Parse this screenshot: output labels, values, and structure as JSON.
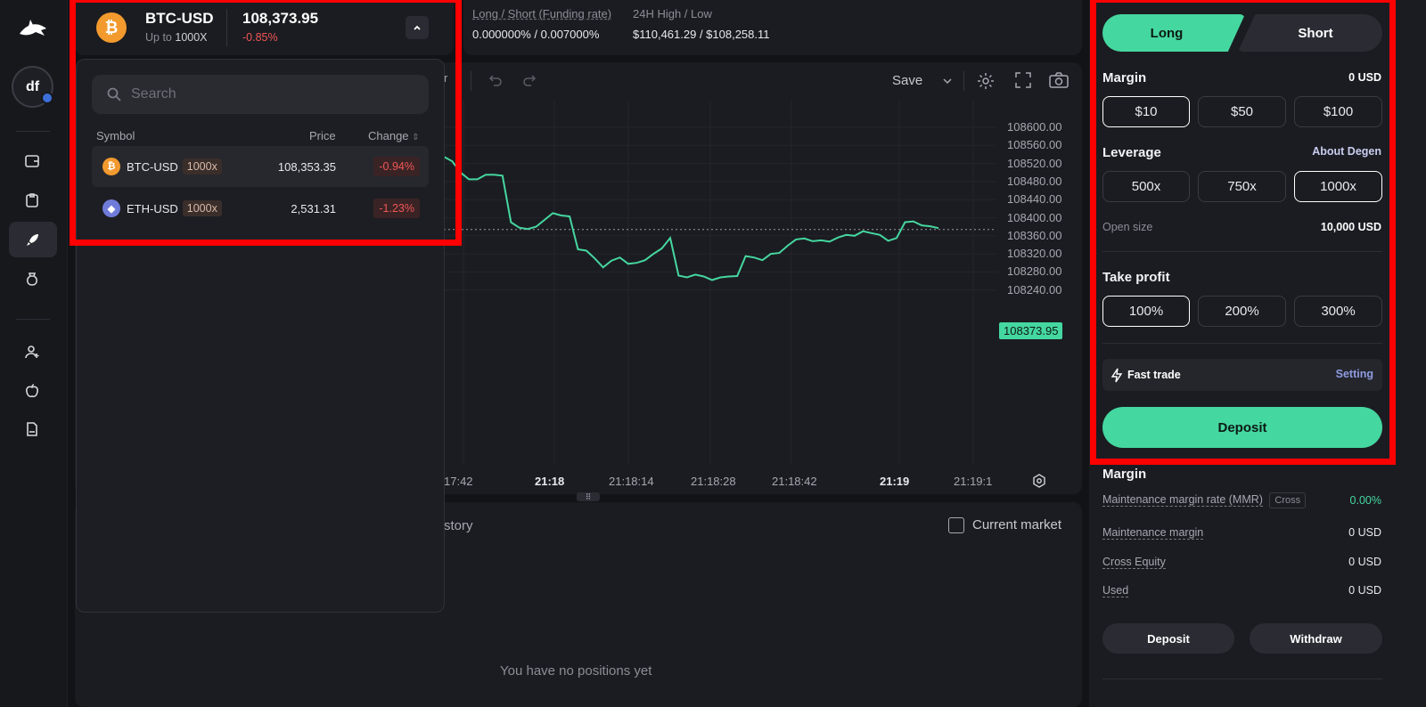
{
  "ticker": {
    "symbol": "BTC-USD",
    "leverage_prefix": "Up to",
    "leverage": "1000X",
    "price": "108,373.95",
    "change": "-0.85%",
    "funding_label": "Long / Short (Funding rate)",
    "funding_value": "0.000000% / 0.007000%",
    "range_label": "24H High / Low",
    "range_value": "$110,461.29 / $108,258.11"
  },
  "dropdown": {
    "search_placeholder": "Search",
    "col_symbol": "Symbol",
    "col_price": "Price",
    "col_change": "Change",
    "rows": [
      {
        "symbol": "BTC-USD",
        "leverage": "1000x",
        "price": "108,353.35",
        "change": "-0.94%",
        "icon": "bitcoin-icon"
      },
      {
        "symbol": "ETH-USD",
        "leverage": "1000x",
        "price": "2,531.31",
        "change": "-1.23%",
        "icon": "ethereum-icon"
      }
    ]
  },
  "chart_toolbar": {
    "save_label": "Save"
  },
  "chart_data": {
    "type": "line",
    "y_ticks": [
      "108600.00",
      "108560.00",
      "108520.00",
      "108480.00",
      "108440.00",
      "108400.00",
      "108360.00",
      "108320.00",
      "108280.00",
      "108240.00"
    ],
    "x_ticks": [
      "17:42",
      "21:18",
      "21:18:14",
      "21:18:28",
      "21:18:42",
      "21:19",
      "21:19:1"
    ],
    "current_price_label": "108373.95",
    "ylim": [
      108240,
      108600
    ],
    "y": [
      108535,
      108525,
      108500,
      108485,
      108485,
      108495,
      108495,
      108493,
      108390,
      108378,
      108375,
      108380,
      108395,
      108410,
      108405,
      108403,
      108330,
      108327,
      108310,
      108290,
      108305,
      108312,
      108298,
      108300,
      108306,
      108320,
      108332,
      108355,
      108272,
      108268,
      108274,
      108270,
      108262,
      108268,
      108270,
      108271,
      108315,
      108312,
      108306,
      108320,
      108322,
      108338,
      108352,
      108354,
      108348,
      108350,
      108347,
      108356,
      108362,
      108360,
      108370,
      108366,
      108362,
      108349,
      108355,
      108390,
      108392,
      108383,
      108381,
      108377
    ],
    "color": "#45d7a0"
  },
  "bottom": {
    "tab_partial": "story",
    "current_market_label": "Current market",
    "empty_text": "You have no positions yet"
  },
  "order": {
    "long_label": "Long",
    "short_label": "Short",
    "margin_title": "Margin",
    "margin_value": "0 USD",
    "margin_options": [
      "$10",
      "$50",
      "$100"
    ],
    "leverage_title": "Leverage",
    "about_label": "About Degen",
    "leverage_options": [
      "500x",
      "750x",
      "1000x"
    ],
    "open_size_label": "Open size",
    "open_size_value": "10,000 USD",
    "tp_title": "Take profit",
    "tp_options": [
      "100%",
      "200%",
      "300%"
    ],
    "fast_trade_label": "Fast trade",
    "setting_label": "Setting",
    "deposit_label": "Deposit"
  },
  "account": {
    "title": "Margin",
    "mmr_label": "Maintenance margin rate (MMR)",
    "cross_label": "Cross",
    "mmr_value": "0.00%",
    "mm_label": "Maintenance margin",
    "mm_value": "0 USD",
    "equity_label": "Cross Equity",
    "equity_value": "0 USD",
    "used_label": "Used",
    "used_value": "0 USD",
    "deposit_label": "Deposit",
    "withdraw_label": "Withdraw"
  },
  "user": {
    "initials": "df"
  },
  "colors": {
    "accent": "#45d7a0",
    "negative": "#ef5656",
    "highlight": "#ff0000"
  }
}
